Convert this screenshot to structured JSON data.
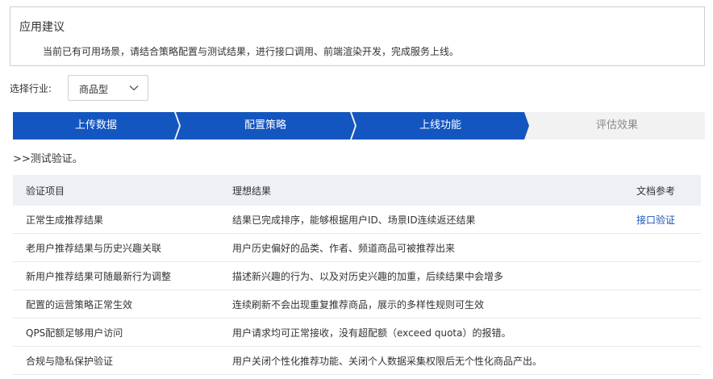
{
  "advice": {
    "title": "应用建议",
    "text": "当前已有可用场景，请结合策略配置与测试结果，进行接口调用、前端渲染开发，完成服务上线。"
  },
  "industry": {
    "label": "选择行业:",
    "selected": "商品型"
  },
  "steps": [
    {
      "label": "上传数据",
      "state": "active"
    },
    {
      "label": "配置策略",
      "state": "active"
    },
    {
      "label": "上线功能",
      "state": "active"
    },
    {
      "label": "评估效果",
      "state": "inactive"
    }
  ],
  "section_title": ">>测试验证。",
  "table": {
    "headers": [
      "验证项目",
      "理想结果",
      "文档参考"
    ],
    "rows": [
      {
        "item": "正常生成推荐结果",
        "result": "结果已完成排序，能够根据用户ID、场景ID连续返还结果",
        "ref": "接口验证"
      },
      {
        "item": "老用户推荐结果与历史兴趣关联",
        "result": "用户历史偏好的品类、作者、频道商品可被推荐出来",
        "ref": ""
      },
      {
        "item": "新用户推荐结果可随最新行为调整",
        "result": "描述新兴趣的行为、以及对历史兴趣的加重，后续结果中会增多",
        "ref": ""
      },
      {
        "item": "配置的运营策略正常生效",
        "result": "连续刷新不会出现重复推荐商品，展示的多样性规则可生效",
        "ref": ""
      },
      {
        "item": "QPS配额足够用户访问",
        "result": "用户请求均可正常接收，没有超配额（exceed quota）的报错。",
        "ref": ""
      },
      {
        "item": "合规与隐私保护验证",
        "result": "用户关闭个性化推荐功能、关闭个人数据采集权限后无个性化商品产出。",
        "ref": ""
      }
    ]
  },
  "colors": {
    "step_active": "#1456c0",
    "step_inactive_bg": "#f2f2f2",
    "link": "#1a56b8",
    "table_header_bg": "#eef0f5"
  },
  "icons": {
    "select_chevron": "chevron-down-icon"
  }
}
